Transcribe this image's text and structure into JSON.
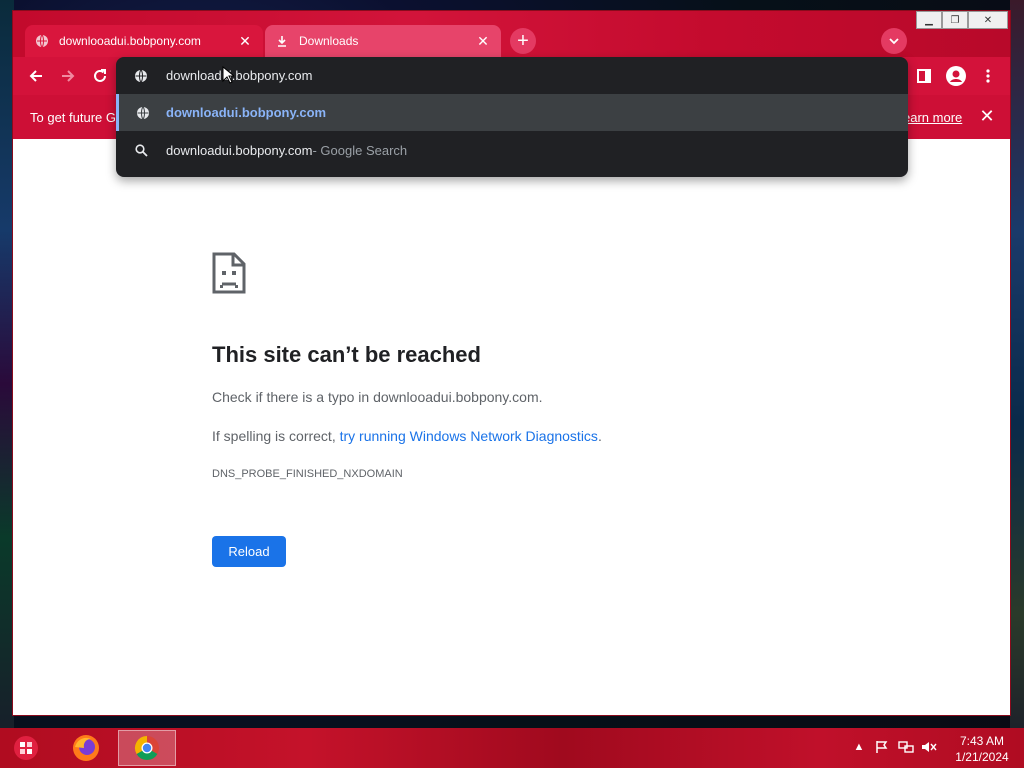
{
  "browser": {
    "tabs": [
      {
        "title": "downlooadui.bobpony.com",
        "active": true,
        "icon": "globe-icon"
      },
      {
        "title": "Downloads",
        "active": false,
        "icon": "download-icon"
      }
    ],
    "new_tab_label": "+",
    "accent": "#d3123a"
  },
  "omnibox": {
    "input_value": "downloadui.bobpony.com",
    "suggestions": [
      {
        "text": "downloadui.bobpony.com",
        "suffix": "",
        "icon": "globe-icon"
      },
      {
        "text": "downloadui.bobpony.com",
        "suffix": " - Google Search",
        "icon": "search-icon"
      }
    ]
  },
  "infobar": {
    "message": "To get future G",
    "learn_more": "earn more",
    "close": "✕"
  },
  "error_page": {
    "title": "This site can’t be reached",
    "check_typo": "Check if there is a typo in downlooadui.bobpony.com.",
    "spelling_prefix": "If spelling is correct, ",
    "diagnostics_link": "try running Windows Network Diagnostics",
    "spelling_suffix": ".",
    "error_code": "DNS_PROBE_FINISHED_NXDOMAIN",
    "reload_label": "Reload"
  },
  "taskbar": {
    "time": "7:43 AM",
    "date": "1/21/2024"
  }
}
